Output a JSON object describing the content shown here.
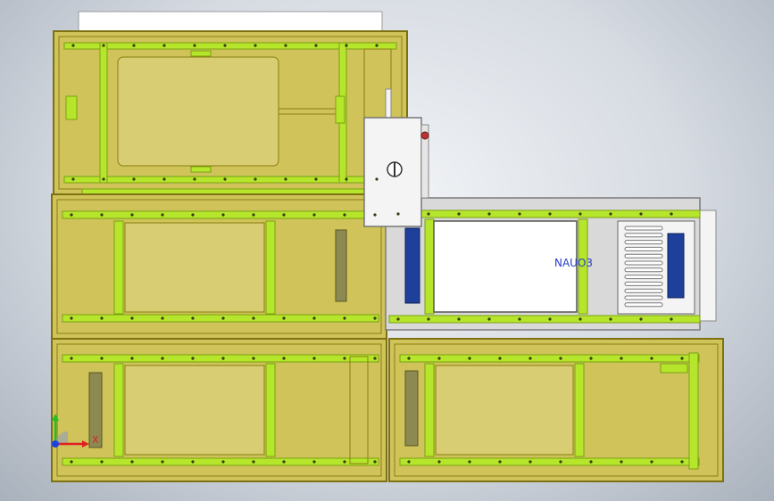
{
  "viewport": {
    "part_label": "NAUO3",
    "triad": {
      "x_label": "X",
      "x_color": "#e02020",
      "y_color": "#20c020",
      "z_color": "#2040e0"
    }
  },
  "colors": {
    "enclosure_fill": "#cfc35a",
    "enclosure_edge": "#8a7d12",
    "rail_green": "#b6e62c",
    "panel_fill": "#d8cd73",
    "housing_gray": "#d9d9d9",
    "white_box": "#f4f4f4",
    "blue_handle": "#1e3f9a"
  }
}
